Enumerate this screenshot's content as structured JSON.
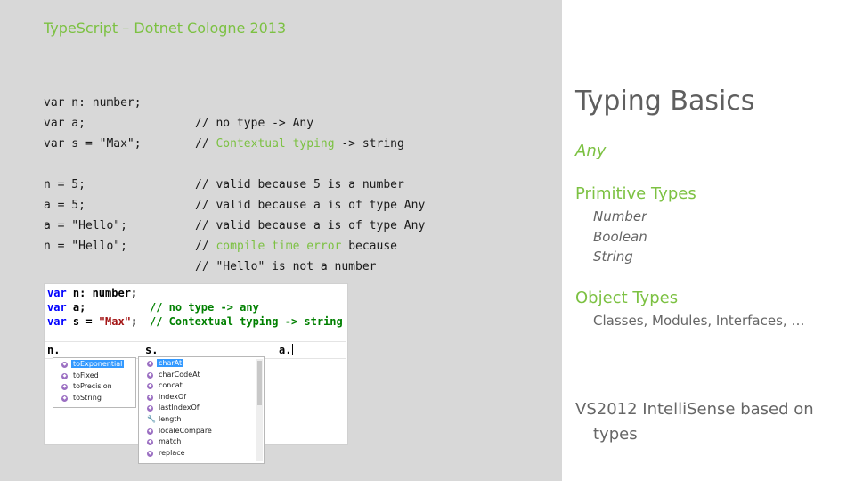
{
  "header": {
    "title": "TypeScript – Dotnet Cologne 2013"
  },
  "code": [
    {
      "c1": "var n: number;",
      "c2": "",
      "c2_green": "",
      "c2_tail": ""
    },
    {
      "c1": "var a;",
      "c2": "// no type -> Any",
      "c2_green": "",
      "c2_tail": ""
    },
    {
      "c1": "var s = \"Max\";",
      "c2": "// ",
      "c2_green": "Contextual typing",
      "c2_tail": " -> string"
    },
    {
      "c1": "",
      "c2": "",
      "c2_green": "",
      "c2_tail": ""
    },
    {
      "c1": "n = 5;",
      "c2": "// valid because 5 is a number",
      "c2_green": "",
      "c2_tail": ""
    },
    {
      "c1": "a = 5;",
      "c2": "// valid because a is of type Any",
      "c2_green": "",
      "c2_tail": ""
    },
    {
      "c1": "a = \"Hello\";",
      "c2": "// valid because a is of type Any",
      "c2_green": "",
      "c2_tail": ""
    },
    {
      "c1": "n = \"Hello\";",
      "c2": "// ",
      "c2_green": "compile time error",
      "c2_tail": " because"
    },
    {
      "c1": "",
      "c2": "// \"Hello\" is not a number",
      "c2_green": "",
      "c2_tail": ""
    }
  ],
  "vs": {
    "line1": {
      "kw": "var",
      "rest": " n: number;"
    },
    "line2": {
      "kw": "var",
      "rest": " a;",
      "comment": "// no type -> any"
    },
    "line3": {
      "kw": "var",
      "rest": " s = ",
      "str": "\"Max\"",
      "semi": ";",
      "comment": "// Contextual typing -> string"
    },
    "edit": {
      "n": "n.",
      "s": "s.",
      "a": "a."
    },
    "popup_number": [
      "toExponential",
      "toFixed",
      "toPrecision",
      "toString"
    ],
    "popup_string": [
      "charAt",
      "charCodeAt",
      "concat",
      "indexOf",
      "lastIndexOf",
      "length",
      "localeCompare",
      "match",
      "replace"
    ],
    "icon_method": "method-icon",
    "icon_property": "wrench-icon",
    "colors": {
      "keyword": "#0000ff",
      "string": "#a31515",
      "comment": "#008000",
      "selection": "#3399ff"
    }
  },
  "slide": {
    "title": "Typing Basics",
    "any": "Any",
    "primitive": "Primitive Types",
    "primitive_items": [
      "Number",
      "Boolean",
      "String"
    ],
    "object": "Object Types",
    "object_items": "Classes, Modules, Interfaces, …",
    "vs_line1": "VS2012 IntelliSense based on",
    "vs_line2": "types"
  },
  "colors": {
    "accent": "#7cc142",
    "left_bg": "#d8d8d8",
    "right_bg": "#ffffff",
    "text_gray": "#666666"
  }
}
